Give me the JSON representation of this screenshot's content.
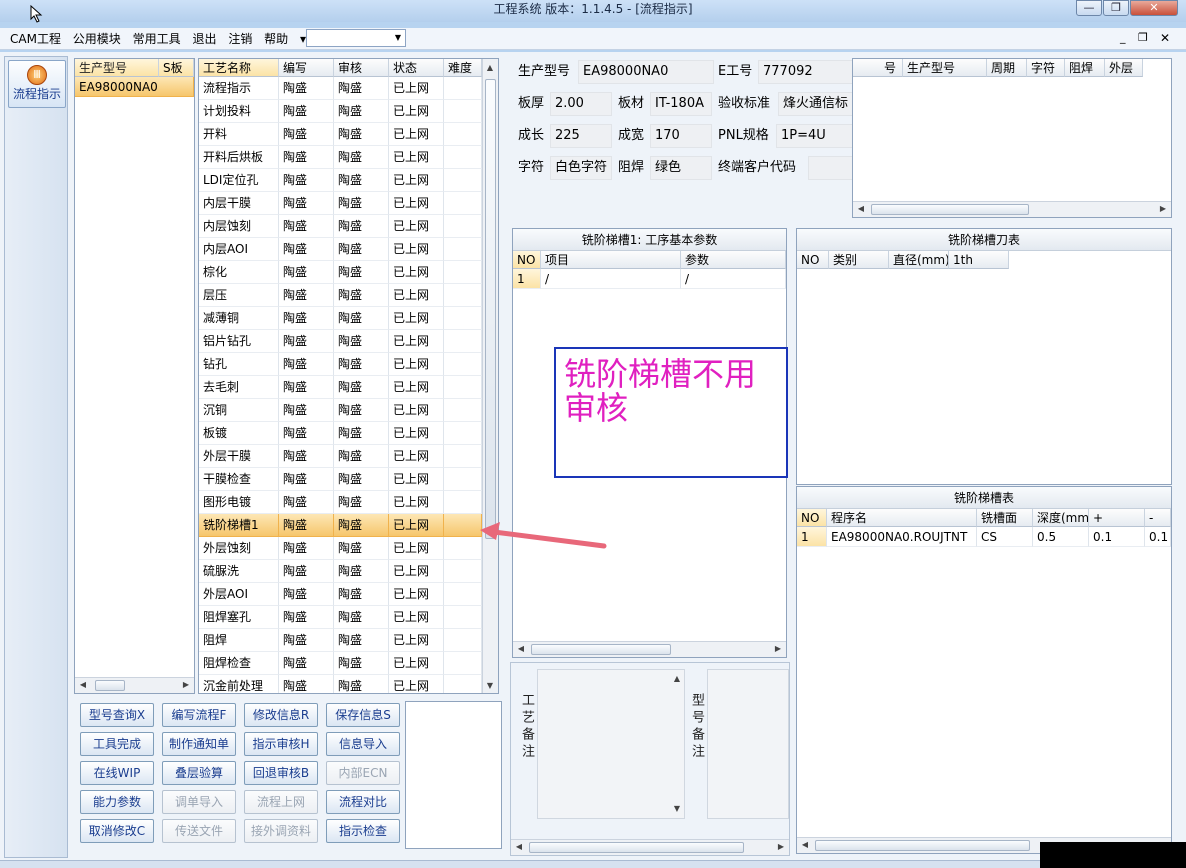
{
  "window": {
    "title": "工程系统   版本：1.1.4.5 - [流程指示]",
    "minimize_icon": "minimize-icon",
    "restore_icon": "restore-icon",
    "close_icon": "close-icon"
  },
  "menubar": {
    "items": [
      "CAM工程",
      "公用模块",
      "常用工具",
      "退出",
      "注销",
      "帮助"
    ],
    "help_arrow": "▾"
  },
  "left_nav": {
    "label": "流程指示"
  },
  "model_list": {
    "headers": [
      "生产型号",
      "S板"
    ],
    "rows": [
      [
        "EA98000NA0",
        ""
      ]
    ]
  },
  "process_table": {
    "headers": [
      "工艺名称",
      "编写",
      "审核",
      "状态",
      "难度"
    ],
    "rows": [
      [
        "流程指示",
        "陶盛",
        "陶盛",
        "已上网"
      ],
      [
        "计划投料",
        "陶盛",
        "陶盛",
        "已上网"
      ],
      [
        "开料",
        "陶盛",
        "陶盛",
        "已上网"
      ],
      [
        "开料后烘板",
        "陶盛",
        "陶盛",
        "已上网"
      ],
      [
        "LDI定位孔",
        "陶盛",
        "陶盛",
        "已上网"
      ],
      [
        "内层干膜",
        "陶盛",
        "陶盛",
        "已上网"
      ],
      [
        "内层蚀刻",
        "陶盛",
        "陶盛",
        "已上网"
      ],
      [
        "内层AOI",
        "陶盛",
        "陶盛",
        "已上网"
      ],
      [
        "棕化",
        "陶盛",
        "陶盛",
        "已上网"
      ],
      [
        "层压",
        "陶盛",
        "陶盛",
        "已上网"
      ],
      [
        "减薄铜",
        "陶盛",
        "陶盛",
        "已上网"
      ],
      [
        "铝片钻孔",
        "陶盛",
        "陶盛",
        "已上网"
      ],
      [
        "钻孔",
        "陶盛",
        "陶盛",
        "已上网"
      ],
      [
        "去毛刺",
        "陶盛",
        "陶盛",
        "已上网"
      ],
      [
        "沉铜",
        "陶盛",
        "陶盛",
        "已上网"
      ],
      [
        "板镀",
        "陶盛",
        "陶盛",
        "已上网"
      ],
      [
        "外层干膜",
        "陶盛",
        "陶盛",
        "已上网"
      ],
      [
        "干膜检查",
        "陶盛",
        "陶盛",
        "已上网"
      ],
      [
        "图形电镀",
        "陶盛",
        "陶盛",
        "已上网"
      ],
      [
        "铣阶梯槽1",
        "陶盛",
        "陶盛",
        "已上网"
      ],
      [
        "外层蚀刻",
        "陶盛",
        "陶盛",
        "已上网"
      ],
      [
        "硫脲洗",
        "陶盛",
        "陶盛",
        "已上网"
      ],
      [
        "外层AOI",
        "陶盛",
        "陶盛",
        "已上网"
      ],
      [
        "阻焊塞孔",
        "陶盛",
        "陶盛",
        "已上网"
      ],
      [
        "阻焊",
        "陶盛",
        "陶盛",
        "已上网"
      ],
      [
        "阻焊检查",
        "陶盛",
        "陶盛",
        "已上网"
      ],
      [
        "沉金前处理",
        "陶盛",
        "陶盛",
        "已上网"
      ]
    ],
    "selected_index": 19
  },
  "buttons": [
    [
      "型号查询X",
      "编写流程F",
      "修改信息R",
      "保存信息S"
    ],
    [
      "工具完成",
      "制作通知单",
      "指示审核H",
      "信息导入"
    ],
    [
      "在线WIP",
      "叠层验算",
      "回退审核B",
      "内部ECN"
    ],
    [
      "能力参数",
      "调单导入",
      "流程上网",
      "流程对比"
    ],
    [
      "取消修改C",
      "传送文件",
      "接外调资料",
      "指示检查"
    ]
  ],
  "disabled_buttons": [
    "内部ECN",
    "调单导入",
    "流程上网",
    "传送文件",
    "接外调资料"
  ],
  "info": {
    "model_label": "生产型号",
    "model_value": "EA98000NA0",
    "eno_label": "E工号",
    "eno_value": "777092",
    "thickness_label": "板厚",
    "thickness_value": "2.00",
    "material_label": "板材",
    "material_value": "IT-180A",
    "standard_label": "验收标准",
    "standard_value": "烽火通信标",
    "length_label": "成长",
    "length_value": "225",
    "width_label": "成宽",
    "width_value": "170",
    "pnl_label": "PNL规格",
    "pnl_value": "1P=4U",
    "char_label": "字符",
    "char_value": "白色字符",
    "mask_label": "阻焊",
    "mask_value": "绿色",
    "customer_label": "终端客户代码",
    "customer_value": ""
  },
  "right_grid": {
    "headers": [
      "号",
      "生产型号",
      "周期",
      "字符",
      "阻焊",
      "外层"
    ]
  },
  "params_panel": {
    "title": "铣阶梯槽1: 工序基本参数",
    "headers": [
      "NO",
      "项目",
      "参数"
    ],
    "rows": [
      [
        "1",
        "/",
        "/"
      ]
    ]
  },
  "annotation": {
    "text": "铣阶梯槽不用审核"
  },
  "tool_panel": {
    "title": "铣阶梯槽刀表",
    "headers": [
      "NO",
      "类别",
      "直径(mm)",
      "1th"
    ]
  },
  "slot_panel": {
    "title": "铣阶梯槽表",
    "headers": [
      "NO",
      "程序名",
      "铣槽面",
      "深度(mm)",
      "+",
      "-"
    ],
    "rows": [
      [
        "1",
        "EA98000NA0.ROUJTNT",
        "CS",
        "0.5",
        "0.1",
        "0.1"
      ]
    ]
  },
  "remarks": {
    "process_label": "工艺备注",
    "model_label": "型号备注"
  },
  "colors": {
    "selected_row": "#f6c66c",
    "annotation_text": "#e020c0",
    "annotation_border": "#1a35b8",
    "arrow": "#e8687a"
  }
}
